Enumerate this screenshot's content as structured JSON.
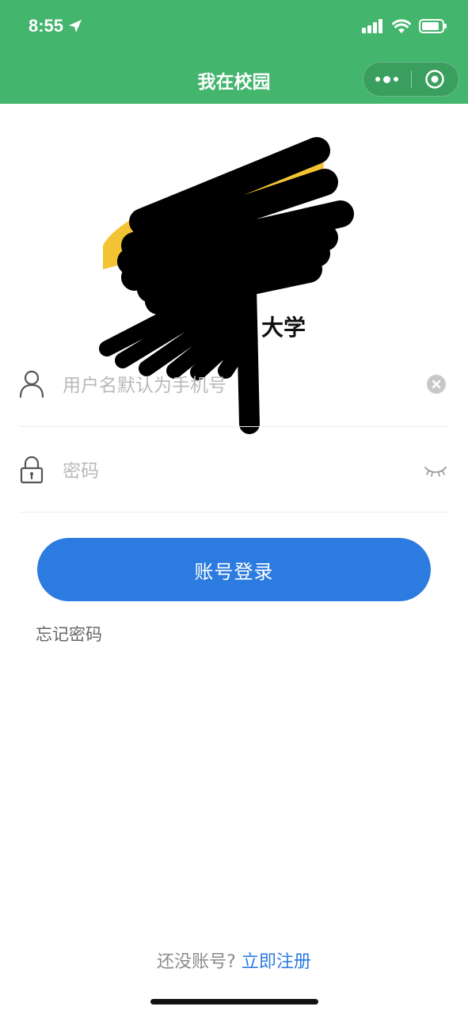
{
  "status_bar": {
    "time": "8:55",
    "icons": [
      "location-arrow-icon",
      "signal-icon",
      "wifi-icon",
      "battery-icon"
    ]
  },
  "nav": {
    "title": "我在校园",
    "more_icon": "more-dots-icon",
    "close_icon": "target-close-icon"
  },
  "school": {
    "name_visible": "大学"
  },
  "login_form": {
    "username_placeholder": "用户名默认为手机号",
    "password_placeholder": "密码",
    "submit_label": "账号登录",
    "forgot_label": "忘记密码"
  },
  "footer": {
    "question": "还没账号?",
    "register_link": "立即注册"
  },
  "colors": {
    "header": "#43b56c",
    "primary": "#2c7be0",
    "placeholder": "#b9b9b9"
  }
}
